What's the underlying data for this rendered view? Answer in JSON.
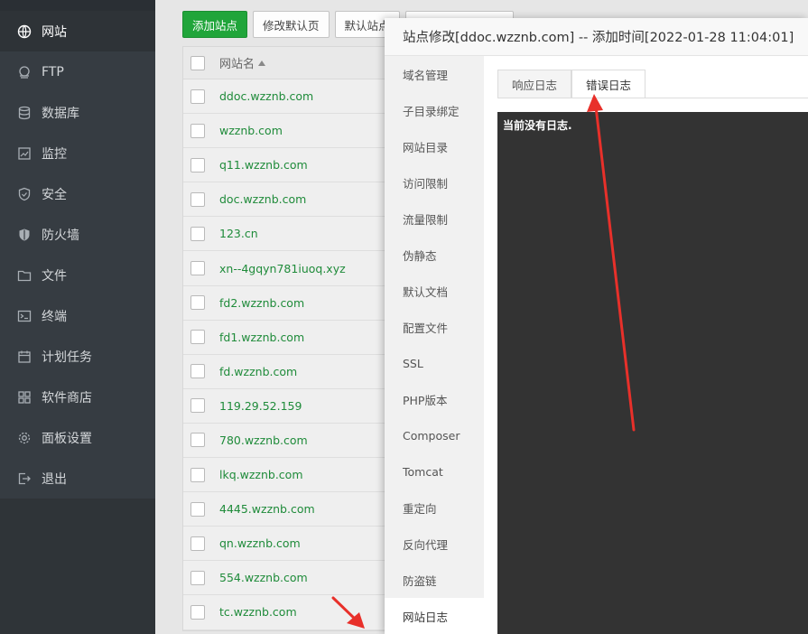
{
  "nav": {
    "items": [
      {
        "label": "网站",
        "icon": "globe-icon",
        "active": true
      },
      {
        "label": "FTP",
        "icon": "ftp-icon"
      },
      {
        "label": "数据库",
        "icon": "database-icon"
      },
      {
        "label": "监控",
        "icon": "monitor-icon"
      },
      {
        "label": "安全",
        "icon": "shield-icon"
      },
      {
        "label": "防火墙",
        "icon": "firewall-icon"
      },
      {
        "label": "文件",
        "icon": "folder-icon"
      },
      {
        "label": "终端",
        "icon": "terminal-icon"
      },
      {
        "label": "计划任务",
        "icon": "calendar-icon"
      },
      {
        "label": "软件商店",
        "icon": "grid-icon"
      },
      {
        "label": "面板设置",
        "icon": "gear-icon"
      },
      {
        "label": "退出",
        "icon": "logout-icon"
      }
    ]
  },
  "toolbar": {
    "add_site": "添加站点",
    "edit_default": "修改默认页",
    "default_site": "默认站点"
  },
  "table": {
    "header_name": "网站名",
    "sites": [
      "ddoc.wzznb.com",
      "wzznb.com",
      "q11.wzznb.com",
      "doc.wzznb.com",
      "123.cn",
      "xn--4gqyn781iuoq.xyz",
      "fd2.wzznb.com",
      "fd1.wzznb.com",
      "fd.wzznb.com",
      "119.29.52.159",
      "780.wzznb.com",
      "lkq.wzznb.com",
      "4445.wzznb.com",
      "qn.wzznb.com",
      "554.wzznb.com",
      "tc.wzznb.com"
    ]
  },
  "modal": {
    "title": "站点修改[ddoc.wzznb.com] -- 添加时间[2022-01-28 11:04:01]",
    "menu": [
      "域名管理",
      "子目录绑定",
      "网站目录",
      "访问限制",
      "流量限制",
      "伪静态",
      "默认文档",
      "配置文件",
      "SSL",
      "PHP版本",
      "Composer",
      "Tomcat",
      "重定向",
      "反向代理",
      "防盗链",
      "网站日志"
    ],
    "active_menu": "网站日志",
    "tabs": [
      "响应日志",
      "错误日志"
    ],
    "active_tab": "错误日志",
    "log_text": "当前没有日志."
  },
  "colors": {
    "nav_bg": "#363c42",
    "accent_green": "#20a53a",
    "link_green": "#1f8b3a",
    "log_bg": "#333333",
    "arrow_red": "#e8302a"
  }
}
